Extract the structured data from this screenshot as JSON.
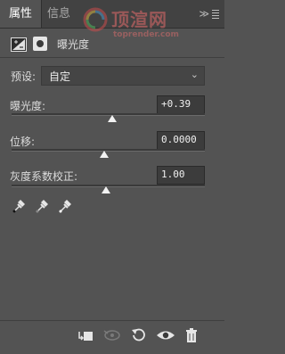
{
  "tabs": [
    {
      "label": "属性"
    },
    {
      "label": "信息"
    }
  ],
  "panel_controls": {
    "collapse": "≫"
  },
  "watermark": {
    "text": "顶渲网",
    "sub": "toprender.com"
  },
  "adjustment": {
    "title": "曝光度"
  },
  "preset": {
    "label": "预设:",
    "value": "自定"
  },
  "sliders": [
    {
      "label": "曝光度:",
      "value": "+0.39"
    },
    {
      "label": "位移:",
      "value": "0.0000"
    },
    {
      "label": "灰度系数校正:",
      "value": "1.00"
    }
  ],
  "slider_levels": [
    0.52,
    0.48,
    0.49
  ],
  "eyedroppers": [
    "black-point-eyedropper-icon",
    "gray-point-eyedropper-icon",
    "white-point-eyedropper-icon"
  ],
  "footer_icons": [
    "clip-to-layer-icon",
    "view-previous-icon",
    "reset-icon",
    "visibility-icon",
    "delete-icon"
  ],
  "colors": {
    "panel": "#535353",
    "tabbar": "#424242",
    "watermark": "#e26b6b"
  }
}
